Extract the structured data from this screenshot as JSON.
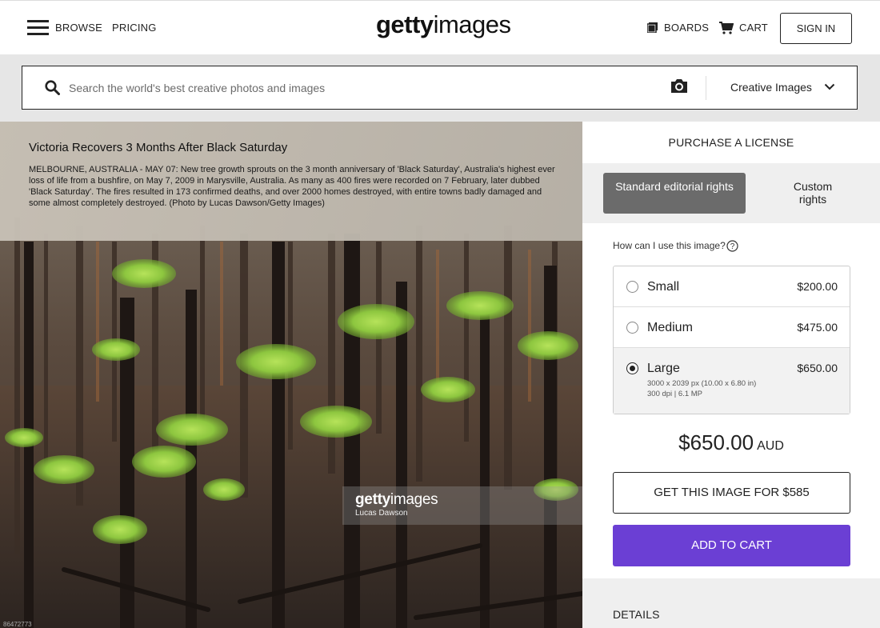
{
  "header": {
    "nav": {
      "browse": "BROWSE",
      "pricing": "PRICING"
    },
    "logo": {
      "bold": "getty",
      "light": "images"
    },
    "boards": "BOARDS",
    "cart": "CART",
    "signin": "SIGN IN"
  },
  "search": {
    "placeholder": "Search the world's best creative photos and images",
    "category": "Creative Images"
  },
  "image": {
    "title": "Victoria Recovers 3 Months After Black Saturday",
    "caption": "MELBOURNE, AUSTRALIA - MAY 07: New tree growth sprouts on the 3 month anniversary of 'Black Saturday', Australia's highest ever loss of life from a bushfire, on May 7, 2009 in Marysville, Australia. As many as 400 fires were recorded on 7 February, later dubbed 'Black Saturday'. The fires resulted in 173 confirmed deaths, and over 2000 homes destroyed, with entire towns badly damaged and some almost completely destroyed. (Photo by Lucas Dawson/Getty Images)",
    "watermark": {
      "bold": "getty",
      "light": "images",
      "credit": "Lucas Dawson"
    },
    "id_label": "86472773"
  },
  "purchase": {
    "title": "PURCHASE A LICENSE",
    "rights_active": "Standard editorial rights",
    "rights_custom": "Custom rights",
    "usage_question": "How can I use this image?",
    "sizes": [
      {
        "name": "Small",
        "price": "$200.00",
        "selected": false
      },
      {
        "name": "Medium",
        "price": "$475.00",
        "selected": false
      },
      {
        "name": "Large",
        "price": "$650.00",
        "selected": true,
        "detail1": "3000 x 2039 px (10.00 x 6.80 in)",
        "detail2": "300 dpi | 6.1 MP"
      }
    ],
    "total_amount": "$650.00",
    "currency": "AUD",
    "get_image": "GET THIS IMAGE FOR $585",
    "add_to_cart": "ADD TO CART",
    "details": "DETAILS"
  },
  "colors": {
    "accent": "#6b3fd4",
    "active_tab": "#6b6b6b"
  },
  "icons": [
    "hamburger-icon",
    "boards-icon",
    "cart-icon",
    "search-icon",
    "camera-icon",
    "chevron-down-icon",
    "help-icon"
  ]
}
